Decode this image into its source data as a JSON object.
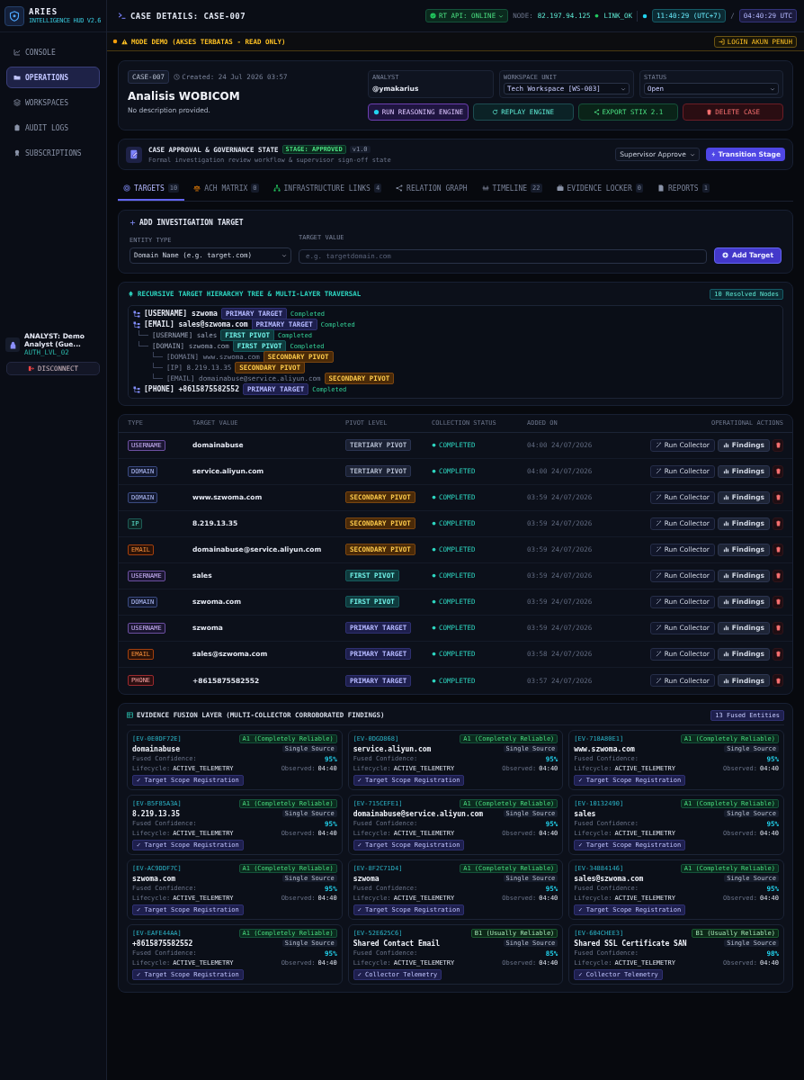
{
  "sidebar": {
    "brand": "ARIES",
    "subtitle": "INTELLIGENCE HUD V2.6",
    "items": [
      {
        "label": "CONSOLE",
        "selected": false
      },
      {
        "label": "OPERATIONS",
        "selected": true
      },
      {
        "label": "WORKSPACES",
        "selected": false
      },
      {
        "label": "AUDIT LOGS",
        "selected": false
      },
      {
        "label": "SUBSCRIPTIONS",
        "selected": false
      }
    ],
    "user": {
      "name": "ANALYST: Demo Analyst (Gue...",
      "level": "AUTH_LVL_02"
    },
    "disconnect": "DISCONNECT"
  },
  "topbar": {
    "title": "CASE DETAILS: CASE-007",
    "api": "RT API: ONLINE",
    "node_label": "NODE:",
    "node": "82.197.94.125",
    "link": "LINK_OK",
    "local_time": "11:40:29 (UTC+7)",
    "separator": "/",
    "utc_time": "04:40:29 UTC"
  },
  "banner": {
    "text": "MODE DEMO (AKSES TERBATAS - READ ONLY)",
    "button": "LOGIN AKUN PENUH"
  },
  "case": {
    "id": "CASE-007",
    "created": "Created: 24 Jul 2026 03:57",
    "title": "Analisis WOBICOM",
    "description": "No description provided.",
    "fields": [
      {
        "kind": "text",
        "label": "ANALYST",
        "value": "@ymakarius"
      },
      {
        "kind": "select",
        "label": "WORKSPACE UNIT",
        "value": "Tech Workspace [WS-003]"
      },
      {
        "kind": "select",
        "label": "STATUS",
        "value": "Open"
      }
    ],
    "buttons": [
      {
        "kind": "reasoning",
        "label": "RUN REASONING ENGINE"
      },
      {
        "kind": "replay",
        "label": "REPLAY ENGINE"
      },
      {
        "kind": "export",
        "label": "EXPORT STIX 2.1"
      },
      {
        "kind": "delete",
        "label": "DELETE CASE"
      }
    ]
  },
  "approval": {
    "title": "CASE APPROVAL & GOVERNANCE STATE",
    "stage": "STAGE: APPROVED",
    "version": "v1.0",
    "subtitle": "Formal investigation review workflow & supervisor sign-off state",
    "select": "Supervisor Approve",
    "button": "Transition Stage"
  },
  "tabs": [
    {
      "label": "TARGETS",
      "count": "10",
      "selected": true
    },
    {
      "label": "ACH MATRIX",
      "count": "0",
      "selected": false
    },
    {
      "label": "INFRASTRUCTURE LINKS",
      "count": "4",
      "selected": false
    },
    {
      "label": "RELATION GRAPH",
      "selected": false
    },
    {
      "label": "TIMELINE",
      "count": "22",
      "selected": false
    },
    {
      "label": "EVIDENCE LOCKER",
      "count": "0",
      "selected": false
    },
    {
      "label": "REPORTS",
      "count": "1",
      "selected": false
    }
  ],
  "add_target": {
    "title": "ADD INVESTIGATION TARGET",
    "entity_label": "ENTITY TYPE",
    "entity_value": "Domain Name (e.g. target.com)",
    "target_label": "TARGET VALUE",
    "placeholder": "e.g. targetdomain.com",
    "button": "Add Target"
  },
  "tree": {
    "title": "RECURSIVE TARGET HIERARCHY TREE & MULTI-LAYER TRAVERSAL",
    "badge": "10 Resolved Nodes",
    "nodes": [
      {
        "label": "[USERNAME] szwoma",
        "tag": {
          "label": "PRIMARY TARGET",
          "kind": "primary"
        },
        "status": "Completed"
      },
      {
        "label": "[EMAIL] sales@szwoma.com",
        "tag": {
          "label": "PRIMARY TARGET",
          "kind": "primary"
        },
        "status": "Completed",
        "children": [
          {
            "label": "[USERNAME] sales",
            "tag": {
              "label": "FIRST PIVOT",
              "kind": "first"
            },
            "status": "Completed"
          },
          {
            "label": "[DOMAIN] szwoma.com",
            "tag": {
              "label": "FIRST PIVOT",
              "kind": "first"
            },
            "status": "Completed",
            "children": [
              {
                "label": "[DOMAIN] www.szwoma.com",
                "tag": {
                  "label": "SECONDARY PIVOT",
                  "kind": "secondary"
                }
              },
              {
                "label": "[IP] 8.219.13.35",
                "tag": {
                  "label": "SECONDARY PIVOT",
                  "kind": "secondary"
                }
              },
              {
                "label": "[EMAIL] domainabuse@service.aliyun.com",
                "tag": {
                  "label": "SECONDARY PIVOT",
                  "kind": "secondary"
                }
              }
            ]
          }
        ]
      },
      {
        "label": "[PHONE] +8615875582552",
        "tag": {
          "label": "PRIMARY TARGET",
          "kind": "primary"
        },
        "status": "Completed"
      }
    ]
  },
  "table": {
    "columns": [
      "TYPE",
      "TARGET VALUE",
      "PIVOT LEVEL",
      "COLLECTION STATUS",
      "ADDED ON",
      "OPERATIONAL ACTIONS"
    ],
    "rows": [
      {
        "type": {
          "label": "USERNAME",
          "kind": "username"
        },
        "value": "domainabuse",
        "pivot": {
          "label": "TERTIARY PIVOT",
          "kind": "tertiary"
        },
        "status": "COMPLETED",
        "added": "04:00 24/07/2026",
        "run": "Run Collector",
        "findings": "Findings"
      },
      {
        "type": {
          "label": "DOMAIN",
          "kind": "domain"
        },
        "value": "service.aliyun.com",
        "pivot": {
          "label": "TERTIARY PIVOT",
          "kind": "tertiary"
        },
        "status": "COMPLETED",
        "added": "04:00 24/07/2026",
        "run": "Run Collector",
        "findings": "Findings"
      },
      {
        "type": {
          "label": "DOMAIN",
          "kind": "domain"
        },
        "value": "www.szwoma.com",
        "pivot": {
          "label": "SECONDARY PIVOT",
          "kind": "secondary"
        },
        "status": "COMPLETED",
        "added": "03:59 24/07/2026",
        "run": "Run Collector",
        "findings": "Findings"
      },
      {
        "type": {
          "label": "IP",
          "kind": "ip"
        },
        "value": "8.219.13.35",
        "pivot": {
          "label": "SECONDARY PIVOT",
          "kind": "secondary"
        },
        "status": "COMPLETED",
        "added": "03:59 24/07/2026",
        "run": "Run Collector",
        "findings": "Findings"
      },
      {
        "type": {
          "label": "EMAIL",
          "kind": "email"
        },
        "value": "domainabuse@service.aliyun.com",
        "pivot": {
          "label": "SECONDARY PIVOT",
          "kind": "secondary"
        },
        "status": "COMPLETED",
        "added": "03:59 24/07/2026",
        "run": "Run Collector",
        "findings": "Findings"
      },
      {
        "type": {
          "label": "USERNAME",
          "kind": "username"
        },
        "value": "sales",
        "pivot": {
          "label": "FIRST PIVOT",
          "kind": "first"
        },
        "status": "COMPLETED",
        "added": "03:59 24/07/2026",
        "run": "Run Collector",
        "findings": "Findings"
      },
      {
        "type": {
          "label": "DOMAIN",
          "kind": "domain"
        },
        "value": "szwoma.com",
        "pivot": {
          "label": "FIRST PIVOT",
          "kind": "first"
        },
        "status": "COMPLETED",
        "added": "03:59 24/07/2026",
        "run": "Run Collector",
        "findings": "Findings"
      },
      {
        "type": {
          "label": "USERNAME",
          "kind": "username"
        },
        "value": "szwoma",
        "pivot": {
          "label": "PRIMARY TARGET",
          "kind": "primary"
        },
        "status": "COMPLETED",
        "added": "03:59 24/07/2026",
        "run": "Run Collector",
        "findings": "Findings"
      },
      {
        "type": {
          "label": "EMAIL",
          "kind": "email"
        },
        "value": "sales@szwoma.com",
        "pivot": {
          "label": "PRIMARY TARGET",
          "kind": "primary"
        },
        "status": "COMPLETED",
        "added": "03:58 24/07/2026",
        "run": "Run Collector",
        "findings": "Findings"
      },
      {
        "type": {
          "label": "PHONE",
          "kind": "phone"
        },
        "value": "+8615875582552",
        "pivot": {
          "label": "PRIMARY TARGET",
          "kind": "primary"
        },
        "status": "COMPLETED",
        "added": "03:57 24/07/2026",
        "run": "Run Collector",
        "findings": "Findings"
      }
    ]
  },
  "evidence": {
    "title": "EVIDENCE FUSION LAYER (MULTI-COLLECTOR CORROBORATED FINDINGS)",
    "badge": "13 Fused Entities",
    "cards": [
      {
        "id": "[EV-0E0DF72E]",
        "reliability": {
          "label": "A1 (Completely Reliable)",
          "kind": "a1"
        },
        "value": "domainabuse",
        "source": "Single Source",
        "confidence_label": "Fused Confidence:",
        "confidence": "95%",
        "lifecycle_label": "Lifecycle:",
        "lifecycle": "ACTIVE_TELEMETRY",
        "observed_label": "Observed:",
        "observed": "04:40",
        "tag": "✓ Target Scope Registration"
      },
      {
        "id": "[EV-0DGD868]",
        "reliability": {
          "label": "A1 (Completely Reliable)",
          "kind": "a1"
        },
        "value": "service.aliyun.com",
        "source": "Single Source",
        "confidence_label": "Fused Confidence:",
        "confidence": "95%",
        "lifecycle_label": "Lifecycle:",
        "lifecycle": "ACTIVE_TELEMETRY",
        "observed_label": "Observed:",
        "observed": "04:40",
        "tag": "✓ Target Scope Registration"
      },
      {
        "id": "[EV-718A80E1]",
        "reliability": {
          "label": "A1 (Completely Reliable)",
          "kind": "a1"
        },
        "value": "www.szwoma.com",
        "source": "Single Source",
        "confidence_label": "Fused Confidence:",
        "confidence": "95%",
        "lifecycle_label": "Lifecycle:",
        "lifecycle": "ACTIVE_TELEMETRY",
        "observed_label": "Observed:",
        "observed": "04:40",
        "tag": "✓ Target Scope Registration"
      },
      {
        "id": "[EV-B5F85A3A]",
        "reliability": {
          "label": "A1 (Completely Reliable)",
          "kind": "a1"
        },
        "value": "8.219.13.35",
        "source": "Single Source",
        "confidence_label": "Fused Confidence:",
        "confidence": "95%",
        "lifecycle_label": "Lifecycle:",
        "lifecycle": "ACTIVE_TELEMETRY",
        "observed_label": "Observed:",
        "observed": "04:40",
        "tag": "✓ Target Scope Registration"
      },
      {
        "id": "[EV-715CEFE1]",
        "reliability": {
          "label": "A1 (Completely Reliable)",
          "kind": "a1"
        },
        "value": "domainabuse@service.aliyun.com",
        "source": "Single Source",
        "confidence_label": "Fused Confidence:",
        "confidence": "95%",
        "lifecycle_label": "Lifecycle:",
        "lifecycle": "ACTIVE_TELEMETRY",
        "observed_label": "Observed:",
        "observed": "04:40",
        "tag": "✓ Target Scope Registration"
      },
      {
        "id": "[EV-10132490]",
        "reliability": {
          "label": "A1 (Completely Reliable)",
          "kind": "a1"
        },
        "value": "sales",
        "source": "Single Source",
        "confidence_label": "Fused Confidence:",
        "confidence": "95%",
        "lifecycle_label": "Lifecycle:",
        "lifecycle": "ACTIVE_TELEMETRY",
        "observed_label": "Observed:",
        "observed": "04:40",
        "tag": "✓ Target Scope Registration"
      },
      {
        "id": "[EV-AC9DDF7C]",
        "reliability": {
          "label": "A1 (Completely Reliable)",
          "kind": "a1"
        },
        "value": "szwoma.com",
        "source": "Single Source",
        "confidence_label": "Fused Confidence:",
        "confidence": "95%",
        "lifecycle_label": "Lifecycle:",
        "lifecycle": "ACTIVE_TELEMETRY",
        "observed_label": "Observed:",
        "observed": "04:40",
        "tag": "✓ Target Scope Registration"
      },
      {
        "id": "[EV-8F2C71D4]",
        "reliability": {
          "label": "A1 (Completely Reliable)",
          "kind": "a1"
        },
        "value": "szwoma",
        "source": "Single Source",
        "confidence_label": "Fused Confidence:",
        "confidence": "95%",
        "lifecycle_label": "Lifecycle:",
        "lifecycle": "ACTIVE_TELEMETRY",
        "observed_label": "Observed:",
        "observed": "04:40",
        "tag": "✓ Target Scope Registration"
      },
      {
        "id": "[EV-34884146]",
        "reliability": {
          "label": "A1 (Completely Reliable)",
          "kind": "a1"
        },
        "value": "sales@szwoma.com",
        "source": "Single Source",
        "confidence_label": "Fused Confidence:",
        "confidence": "95%",
        "lifecycle_label": "Lifecycle:",
        "lifecycle": "ACTIVE_TELEMETRY",
        "observed_label": "Observed:",
        "observed": "04:40",
        "tag": "✓ Target Scope Registration"
      },
      {
        "id": "[EV-EAFE44AA]",
        "reliability": {
          "label": "A1 (Completely Reliable)",
          "kind": "a1"
        },
        "value": "+8615875582552",
        "source": "Single Source",
        "confidence_label": "Fused Confidence:",
        "confidence": "95%",
        "lifecycle_label": "Lifecycle:",
        "lifecycle": "ACTIVE_TELEMETRY",
        "observed_label": "Observed:",
        "observed": "04:40",
        "tag": "✓ Target Scope Registration"
      },
      {
        "id": "[EV-52E625C6]",
        "reliability": {
          "label": "B1 (Usually Reliable)",
          "kind": "b1"
        },
        "value": "Shared Contact Email",
        "source": "Single Source",
        "confidence_label": "Fused Confidence:",
        "confidence": "85%",
        "lifecycle_label": "Lifecycle:",
        "lifecycle": "ACTIVE_TELEMETRY",
        "observed_label": "Observed:",
        "observed": "04:40",
        "tag": "✓ Collector Telemetry"
      },
      {
        "id": "[EV-604CHEE3]",
        "reliability": {
          "label": "B1 (Usually Reliable)",
          "kind": "b1"
        },
        "value": "Shared SSL Certificate SAN",
        "source": "Single Source",
        "confidence_label": "Fused Confidence:",
        "confidence": "98%",
        "lifecycle_label": "Lifecycle:",
        "lifecycle": "ACTIVE_TELEMETRY",
        "observed_label": "Observed:",
        "observed": "04:40",
        "tag": "✓ Collector Telemetry"
      }
    ]
  }
}
